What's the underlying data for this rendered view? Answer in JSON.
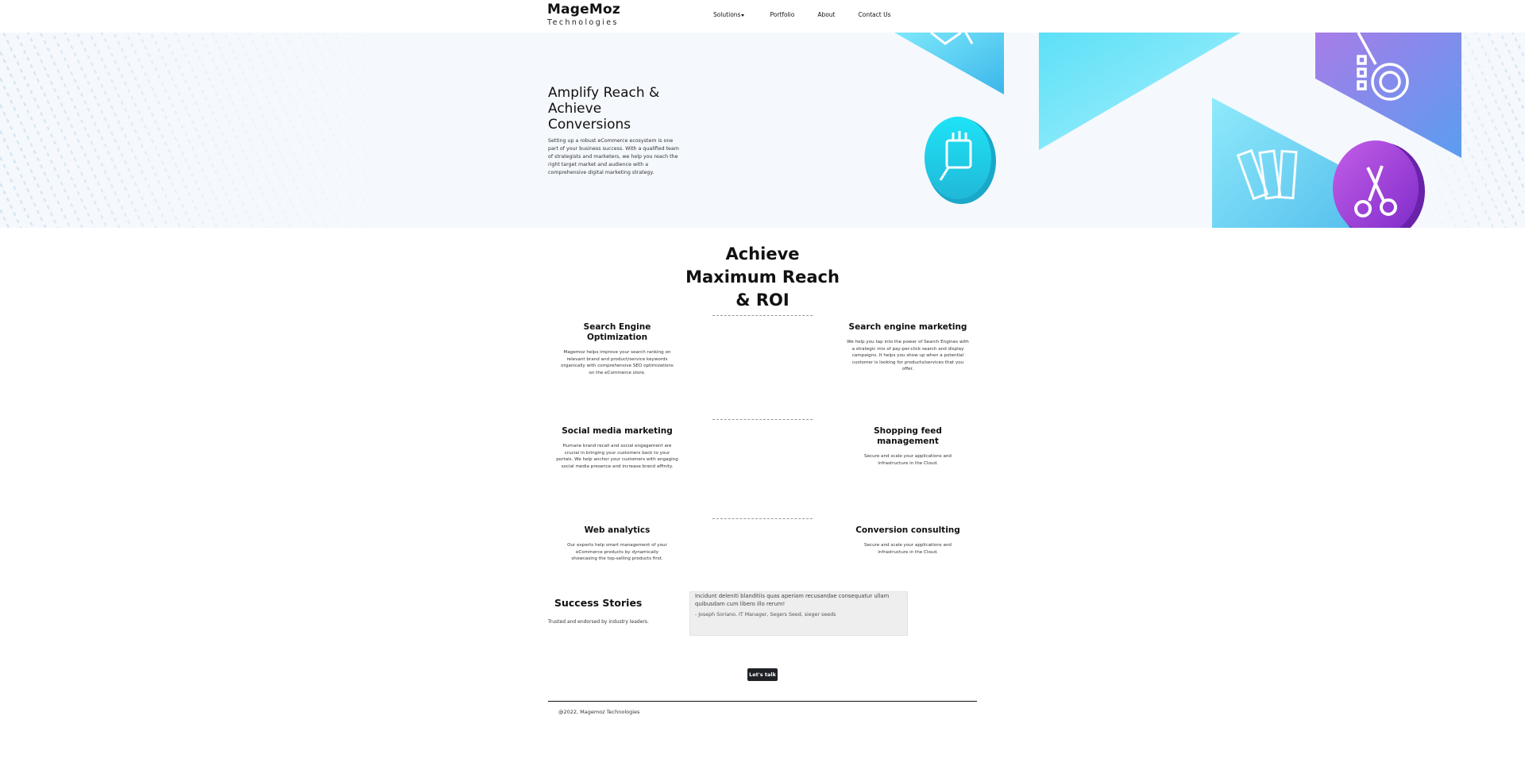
{
  "brand": {
    "name": "MageMoz",
    "tagline": "Technologies"
  },
  "nav": {
    "items": [
      {
        "label": "Solutions",
        "has_dropdown": true
      },
      {
        "label": "Portfolio"
      },
      {
        "label": "About"
      },
      {
        "label": "Contact Us"
      }
    ]
  },
  "hero": {
    "title": "Amplify Reach & Achieve Conversions",
    "description": "Setting up a robust eCommerce ecosystem is one part of your business success. With a qualified team of strategists and marketers, we help you reach the right target market and audience with a comprehensive digital marketing strategy."
  },
  "services_section": {
    "title": "Achieve Maximum Reach & ROI",
    "items": [
      {
        "title": "Search Engine Optimization",
        "description": "Magemoz helps improve your search ranking on relevant brand and product/service keywords organically with comprehensive SEO optimizations on the eCommerce store."
      },
      {
        "title": "Search engine marketing",
        "description": "We help you tap into the power of Search Engines with a strategic mix of pay-per-click search and display campaigns. It helps you show up when a potential customer is looking for products/services that you offer."
      },
      {
        "title": "Social media marketing",
        "description": "Humane brand recall and social engagement are crucial in bringing your customers back to your portals. We help anchor your customers with engaging social media presence and increase brand affinity."
      },
      {
        "title": "Shopping feed management",
        "description": "Secure and scale your applications and infrastructure in the Cloud."
      },
      {
        "title": "Web analytics",
        "description": "Our experts help smart management of your eCommerce products by dynamically showcasing the top-selling products first."
      },
      {
        "title": "Conversion consulting",
        "description": "Secure and scale your applications and infrastructure in the Cloud."
      }
    ]
  },
  "success_stories": {
    "title": "Success Stories",
    "subtitle": "Trusted and endorsed by industry leaders.",
    "quote": "Incidunt deleniti blanditiis quas aperiam recusandae consequatur ullam quibusdam cum libero illo rerum!",
    "author": "- Joseph Soriano, IT Manager, Segers Seed, sieger seeds"
  },
  "cta": {
    "label": "Let's talk"
  },
  "footer": {
    "copyright": "@2022, Magemoz Technologies"
  },
  "colors": {
    "hero_bg": "#f5f8fc",
    "cyan": "#4fd6f2",
    "purple": "#9b4fd6",
    "button_bg": "#1e2126"
  }
}
